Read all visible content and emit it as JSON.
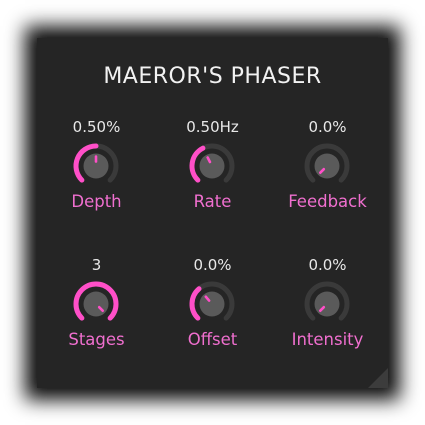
{
  "title": "MAEROR'S PHASER",
  "colors": {
    "panel": "#252525",
    "accent": "#ff4fc8",
    "track": "#3a3a3a",
    "knob_body": "#5a5a5a",
    "label": "#f06fcf"
  },
  "knobs": [
    {
      "label": "Depth",
      "value": "0.50%",
      "level": 0.5
    },
    {
      "label": "Rate",
      "value": "0.50Hz",
      "level": 0.4
    },
    {
      "label": "Feedback",
      "value": "0.0%",
      "level": 0.0
    },
    {
      "label": "Stages",
      "value": "3",
      "level": 1.0
    },
    {
      "label": "Offset",
      "value": "0.0%",
      "level": 0.35
    },
    {
      "label": "Intensity",
      "value": "0.0%",
      "level": 0.0
    }
  ]
}
